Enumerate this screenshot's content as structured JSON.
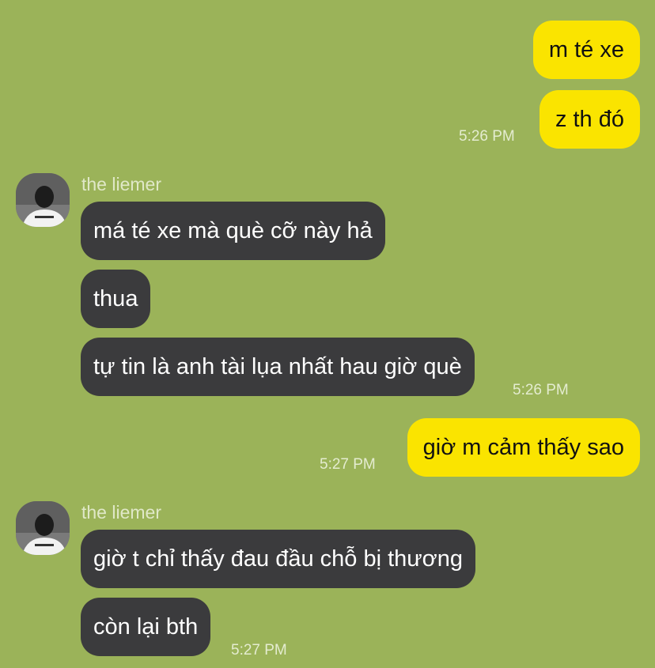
{
  "conversation": {
    "contact_name": "the liemer",
    "messages": {
      "out1": "m té xe",
      "out2": "z th đó",
      "in1": "má té xe mà què cỡ này hả",
      "in2": "thua",
      "in3": "tự tin là anh tài lụa nhất hau giờ què",
      "out3": "giờ m cảm thấy sao",
      "in4": "giờ t chỉ thấy đau đầu chỗ bị thương",
      "in5": "còn lại bth"
    },
    "times": {
      "t1": "5:26 PM",
      "t2": "5:26 PM",
      "t3": "5:27 PM",
      "t4": "5:27 PM"
    }
  },
  "colors": {
    "background": "#9bb359",
    "outgoing_bubble": "#fae400",
    "incoming_bubble": "#3b3b3d"
  }
}
